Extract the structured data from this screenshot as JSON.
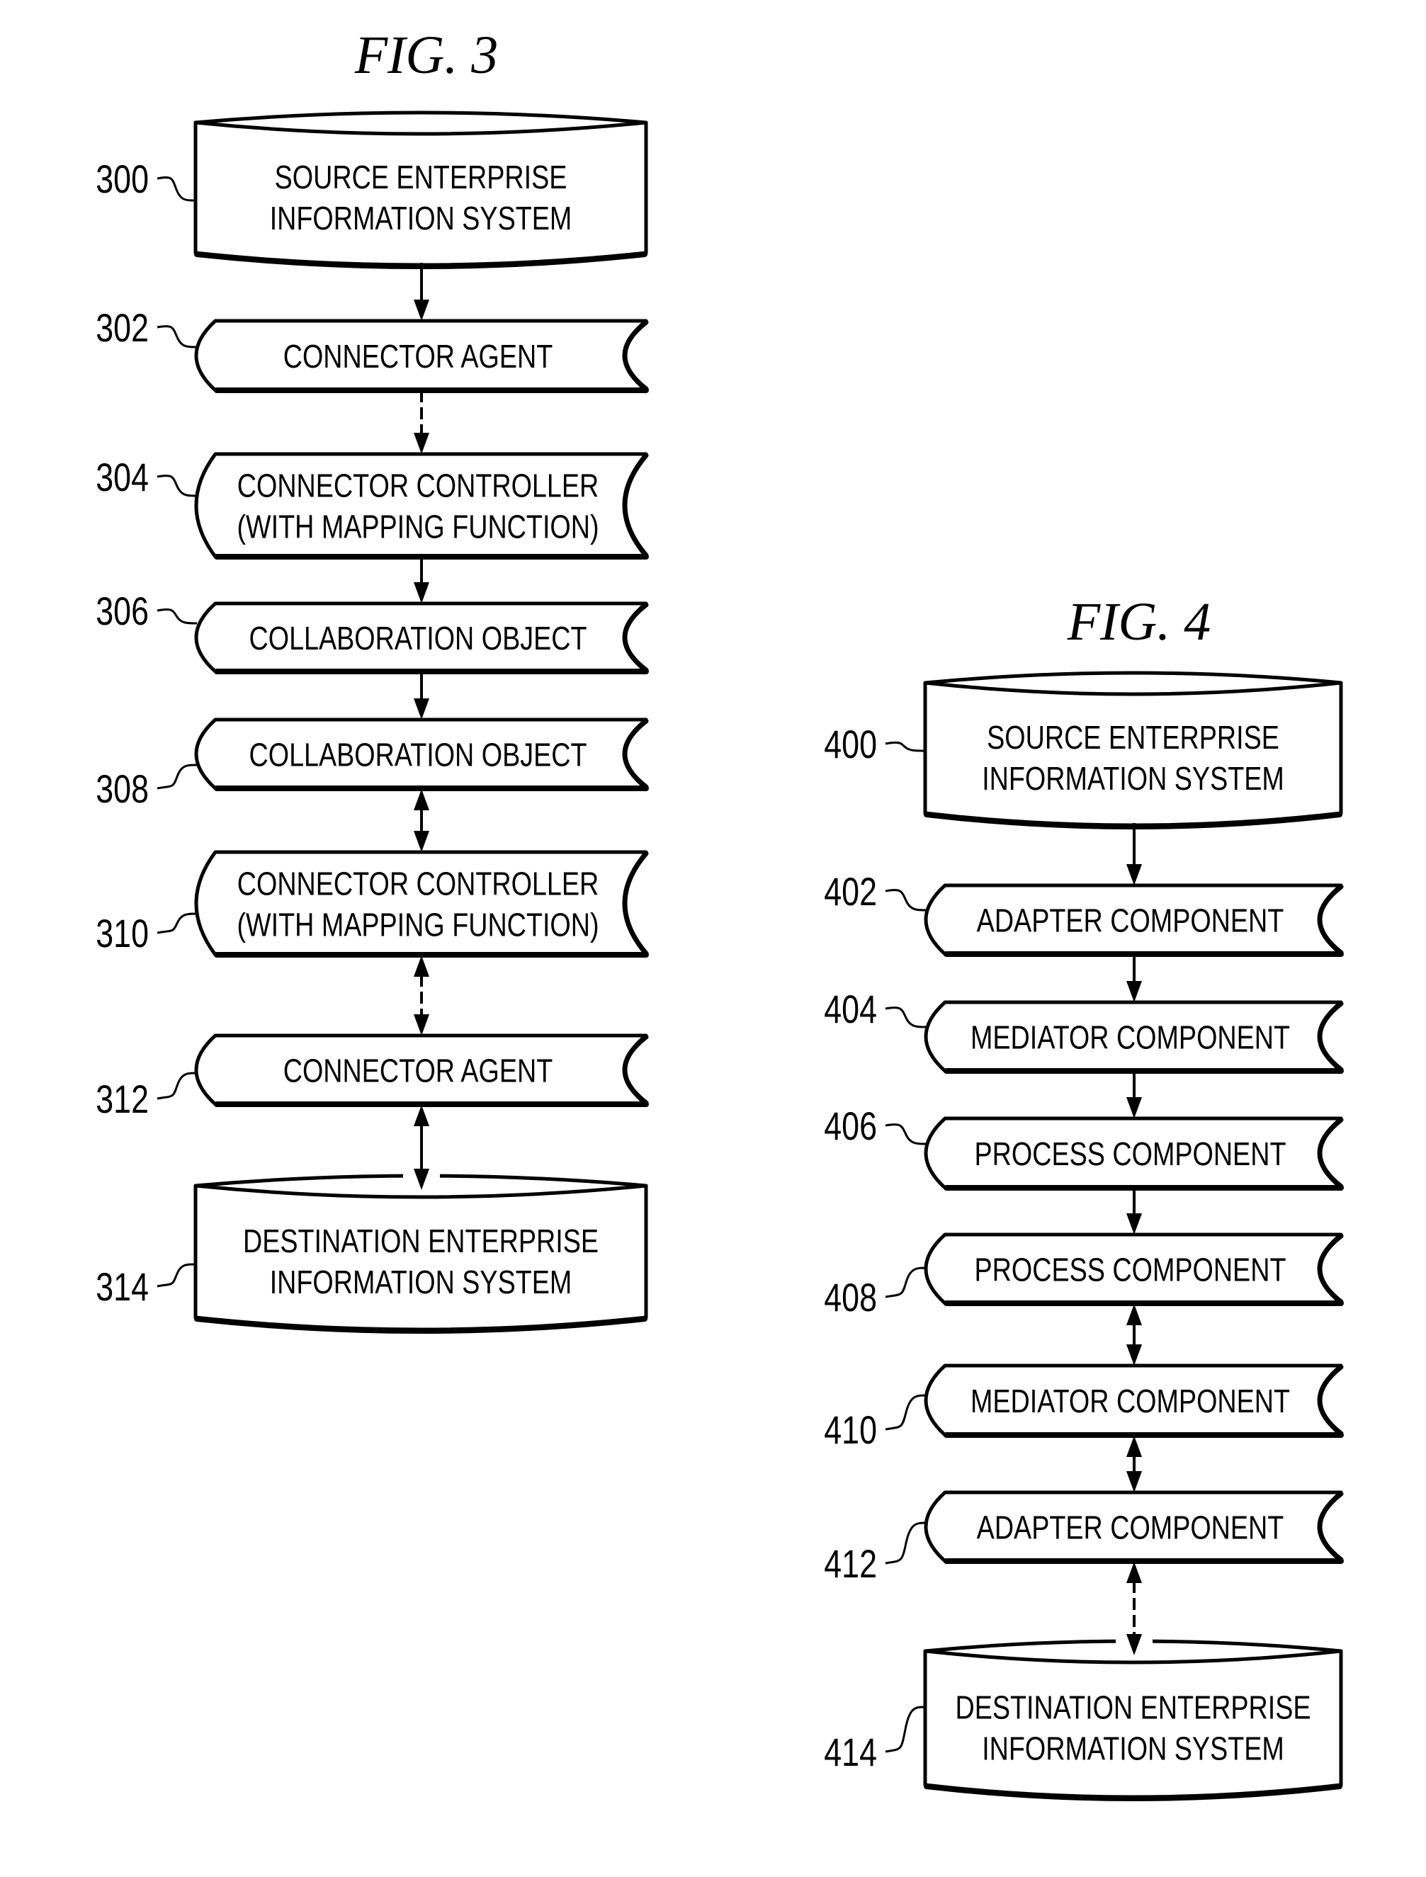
{
  "figures": [
    {
      "id": "fig3",
      "title": "FIG. 3",
      "nodes": [
        {
          "ref": "300",
          "shape": "cylinder",
          "lines": [
            "SOURCE ENTERPRISE",
            "INFORMATION SYSTEM"
          ]
        },
        {
          "ref": "302",
          "shape": "stored-data",
          "lines": [
            "CONNECTOR AGENT"
          ]
        },
        {
          "ref": "304",
          "shape": "stored-data",
          "lines": [
            "CONNECTOR CONTROLLER",
            "(WITH MAPPING FUNCTION)"
          ]
        },
        {
          "ref": "306",
          "shape": "stored-data",
          "lines": [
            "COLLABORATION OBJECT"
          ]
        },
        {
          "ref": "308",
          "shape": "stored-data",
          "lines": [
            "COLLABORATION OBJECT"
          ]
        },
        {
          "ref": "310",
          "shape": "stored-data",
          "lines": [
            "CONNECTOR CONTROLLER",
            "(WITH MAPPING FUNCTION)"
          ]
        },
        {
          "ref": "312",
          "shape": "stored-data",
          "lines": [
            "CONNECTOR AGENT"
          ]
        },
        {
          "ref": "314",
          "shape": "cylinder",
          "lines": [
            "DESTINATION ENTERPRISE",
            "INFORMATION SYSTEM"
          ]
        }
      ],
      "edges": [
        {
          "from": "300",
          "to": "302",
          "style": "solid",
          "direction": "forward"
        },
        {
          "from": "302",
          "to": "304",
          "style": "dashed",
          "direction": "forward"
        },
        {
          "from": "304",
          "to": "306",
          "style": "solid",
          "direction": "forward"
        },
        {
          "from": "306",
          "to": "308",
          "style": "solid",
          "direction": "forward"
        },
        {
          "from": "308",
          "to": "310",
          "style": "solid",
          "direction": "both"
        },
        {
          "from": "310",
          "to": "312",
          "style": "dashed",
          "direction": "both"
        },
        {
          "from": "312",
          "to": "314",
          "style": "solid",
          "direction": "both"
        }
      ]
    },
    {
      "id": "fig4",
      "title": "FIG. 4",
      "nodes": [
        {
          "ref": "400",
          "shape": "cylinder",
          "lines": [
            "SOURCE ENTERPRISE",
            "INFORMATION SYSTEM"
          ]
        },
        {
          "ref": "402",
          "shape": "stored-data",
          "lines": [
            "ADAPTER COMPONENT"
          ]
        },
        {
          "ref": "404",
          "shape": "stored-data",
          "lines": [
            "MEDIATOR COMPONENT"
          ]
        },
        {
          "ref": "406",
          "shape": "stored-data",
          "lines": [
            "PROCESS COMPONENT"
          ]
        },
        {
          "ref": "408",
          "shape": "stored-data",
          "lines": [
            "PROCESS COMPONENT"
          ]
        },
        {
          "ref": "410",
          "shape": "stored-data",
          "lines": [
            "MEDIATOR COMPONENT"
          ]
        },
        {
          "ref": "412",
          "shape": "stored-data",
          "lines": [
            "ADAPTER COMPONENT"
          ]
        },
        {
          "ref": "414",
          "shape": "cylinder",
          "lines": [
            "DESTINATION ENTERPRISE",
            "INFORMATION SYSTEM"
          ]
        }
      ],
      "edges": [
        {
          "from": "400",
          "to": "402",
          "style": "solid",
          "direction": "forward"
        },
        {
          "from": "402",
          "to": "404",
          "style": "solid",
          "direction": "forward"
        },
        {
          "from": "404",
          "to": "406",
          "style": "solid",
          "direction": "forward"
        },
        {
          "from": "406",
          "to": "408",
          "style": "solid",
          "direction": "forward"
        },
        {
          "from": "408",
          "to": "410",
          "style": "solid",
          "direction": "both"
        },
        {
          "from": "410",
          "to": "412",
          "style": "solid",
          "direction": "both"
        },
        {
          "from": "412",
          "to": "414",
          "style": "dashed",
          "direction": "both"
        }
      ]
    }
  ]
}
